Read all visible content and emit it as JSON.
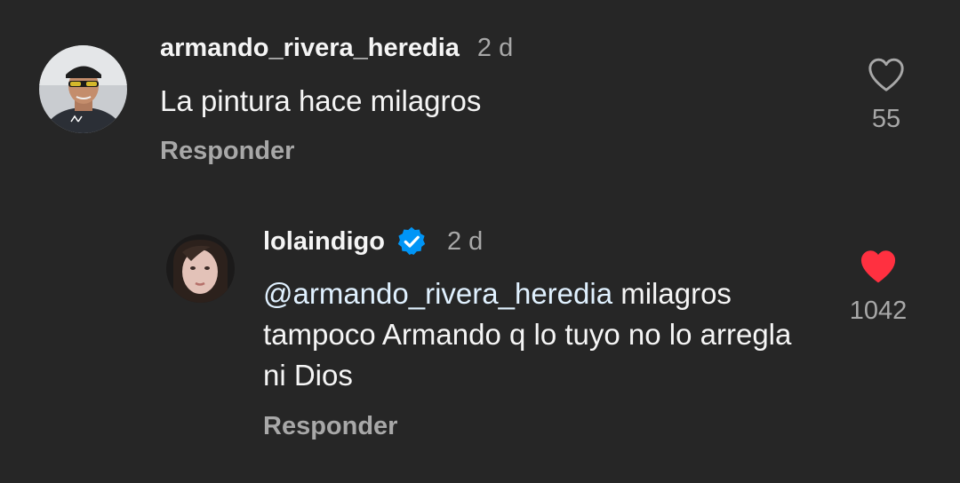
{
  "comment": {
    "username": "armando_rivera_heredia",
    "time": "2 d",
    "text": "La pintura hace milagros",
    "reply_label": "Responder",
    "likes": "55",
    "liked": false
  },
  "reply": {
    "username": "lolaindigo",
    "verified": true,
    "time": "2 d",
    "mention": "@armando_rivera_heredia",
    "text": " milagros tampoco Armando q lo tuyo no lo arregla ni Dios",
    "reply_label": "Responder",
    "likes": "1042",
    "liked": true
  },
  "colors": {
    "background": "#262626",
    "primary_text": "#f5f5f5",
    "secondary_text": "#a8a8a8",
    "mention": "#e0f1ff",
    "liked_heart": "#ff3040",
    "verified_badge": "#0095f6"
  },
  "icons": {
    "comment_like": "heart-outline-icon",
    "reply_like": "heart-filled-icon",
    "verified": "verified-badge-icon"
  }
}
